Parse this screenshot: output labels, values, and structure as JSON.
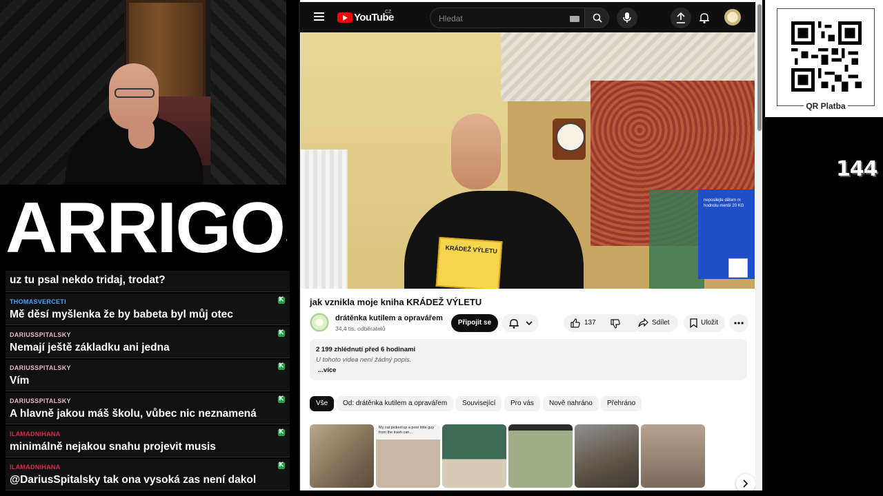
{
  "logo_text": "ARRIGOS",
  "chat": {
    "first_message": "uz tu psal nekdo tridaj, trodat?",
    "messages": [
      {
        "user": "THOMASVERCETI",
        "color": "#4aa3ff",
        "text": "Mě děsí myšlenka že by babeta byl můj otec"
      },
      {
        "user": "DARIUSSPITALSKY",
        "color": "#e8b4c8",
        "text": "Nemají ještě základku ani jedna"
      },
      {
        "user": "DARIUSSPITALSKY",
        "color": "#e8b4c8",
        "text": "Vím"
      },
      {
        "user": "DARIUSSPITALSKY",
        "color": "#e8b4c8",
        "text": "A hlavně jakou máš školu, vůbec nic neznamená"
      },
      {
        "user": "ILAMADNIHANA",
        "color": "#e0254f",
        "text": "minimálně nejakou snahu projevit musis"
      },
      {
        "user": "ILAMADNIHANA",
        "color": "#e0254f",
        "text": "@DariusSpitalsky tak ona vysoká zas není dakol"
      }
    ]
  },
  "youtube": {
    "logo": "YouTube",
    "country": "CZ",
    "search_placeholder": "Hledat",
    "video_book_text": "KRÁDEŽ VÝLETU",
    "video_sign_text": "neposilejte dětem m hodnotu menší 20 KG",
    "title": "jak vznikla moje kniha KRÁDEŽ VÝLETU",
    "channel": "drátěnka kutilem a opravářem",
    "subscribers": "34,4 tis. odběratelů",
    "subscribe_label": "Připojit se",
    "likes": "137",
    "share_label": "Sdílet",
    "save_label": "Uložit",
    "views_date": "2 199 zhlédnutí  před 6 hodinami",
    "no_description": "U tohoto videa není žádný popis.",
    "more_label": "...více",
    "chips": [
      "Vše",
      "Od: drátěnka kutilem a opravářem",
      "Související",
      "Pro vás",
      "Nově nahráno",
      "Přehráno"
    ],
    "thumb_caption": "My cat picked up a poor little guy from the trash can..."
  },
  "qr": {
    "label": "QR Platba"
  },
  "counter": "144",
  "colors": {
    "yt_red": "#ff0000",
    "chat_bg": "#111111",
    "accent_green": "#2f9e44"
  }
}
